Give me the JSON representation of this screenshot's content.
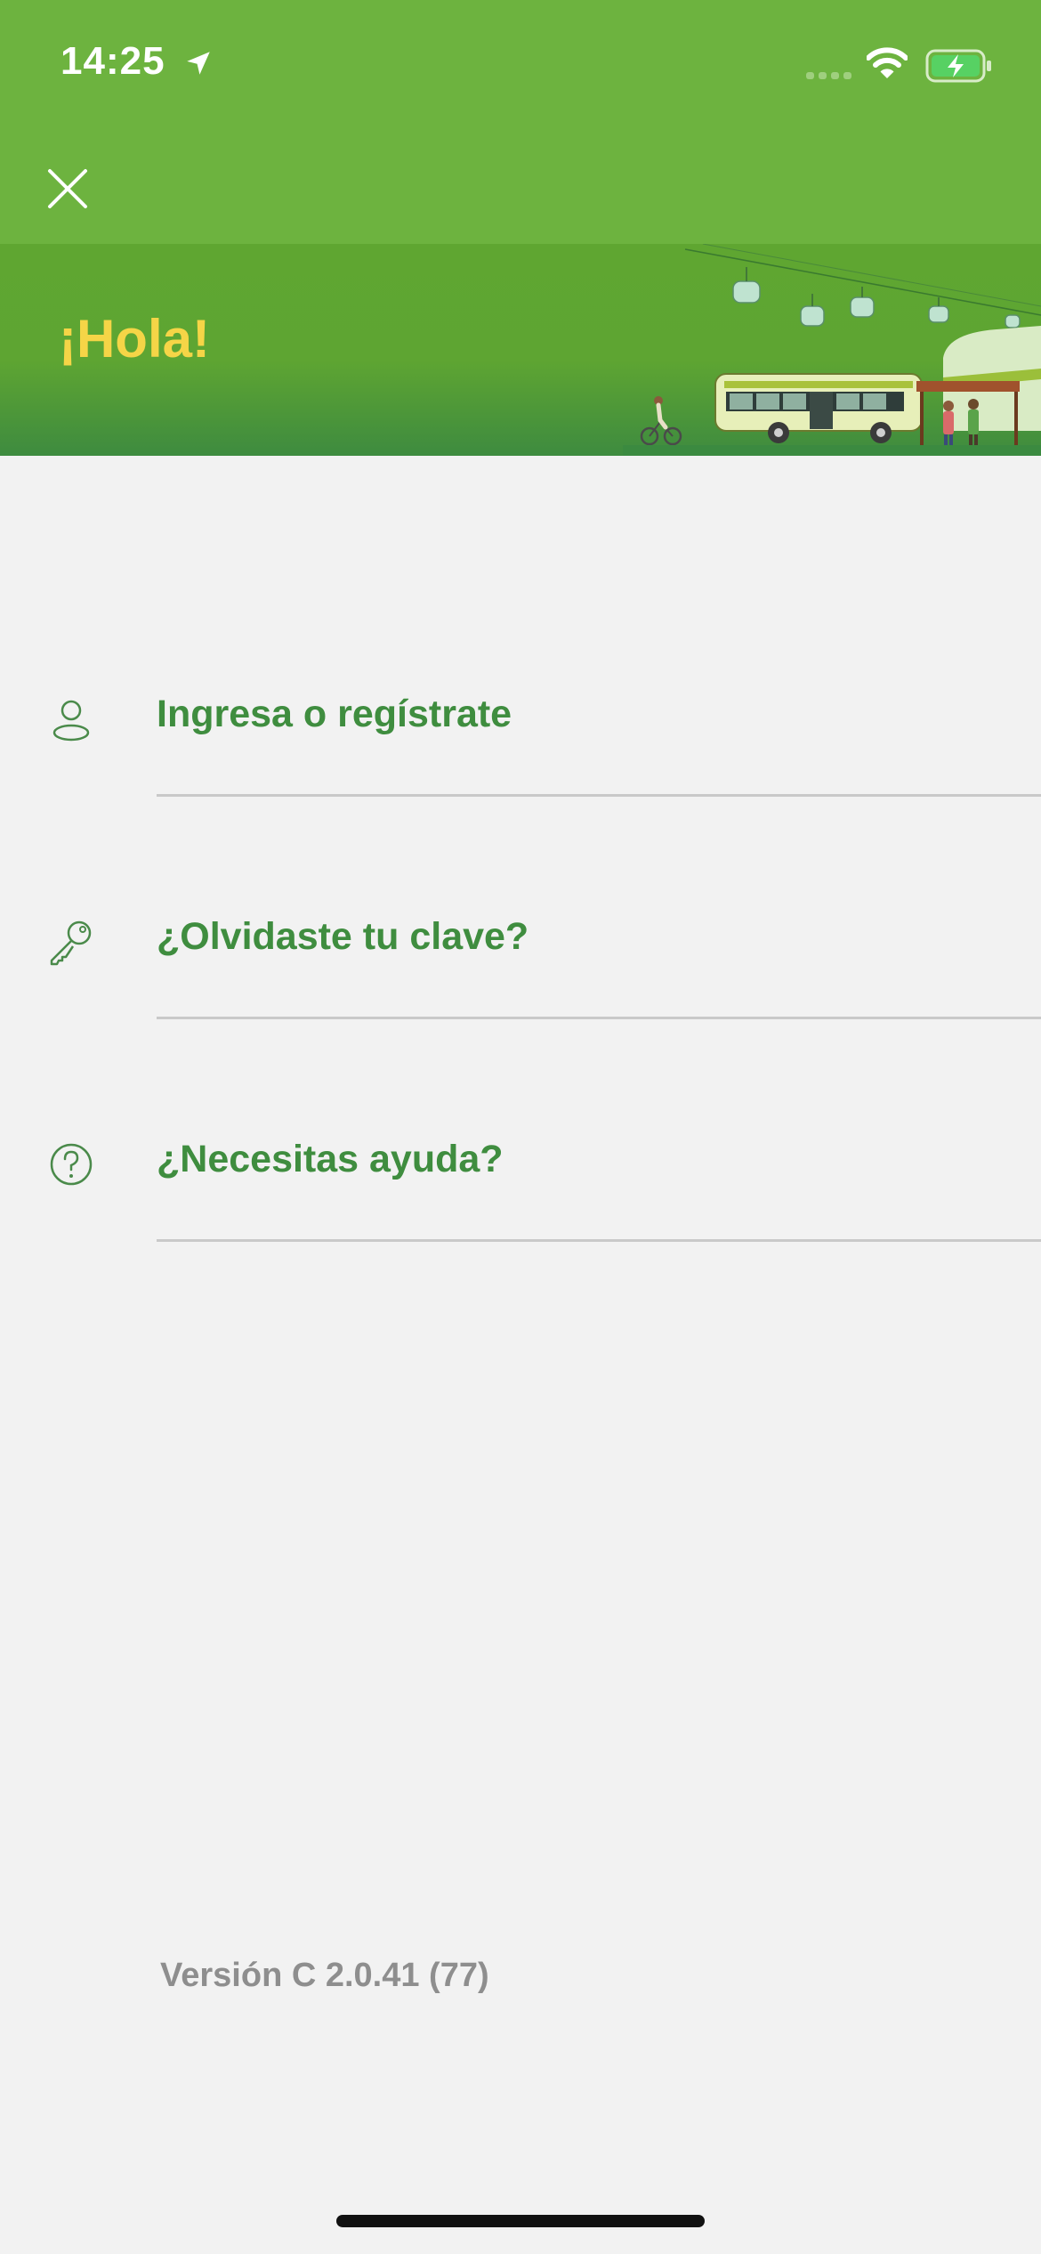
{
  "status_bar": {
    "time": "14:25",
    "icons": [
      "location-arrow-icon",
      "cellular-signal-icon",
      "wifi-icon",
      "battery-charging-icon"
    ]
  },
  "nav": {
    "close_icon": "close-icon"
  },
  "banner": {
    "greeting": "¡Hola!",
    "illustration": "transit-illustration"
  },
  "menu": {
    "items": [
      {
        "label": "Ingresa o regístrate",
        "icon": "user-icon"
      },
      {
        "label": "¿Olvidaste tu clave?",
        "icon": "key-icon"
      },
      {
        "label": "¿Necesitas ayuda?",
        "icon": "help-circle-icon"
      }
    ]
  },
  "footer": {
    "version": "Versión C 2.0.41 (77)"
  },
  "colors": {
    "header_green": "#6db33f",
    "banner_green": "#5ea532",
    "greeting_yellow": "#f5d547",
    "menu_text_green": "#3f8d3f",
    "background": "#f2f2f2",
    "version_gray": "#8e8e8e"
  }
}
